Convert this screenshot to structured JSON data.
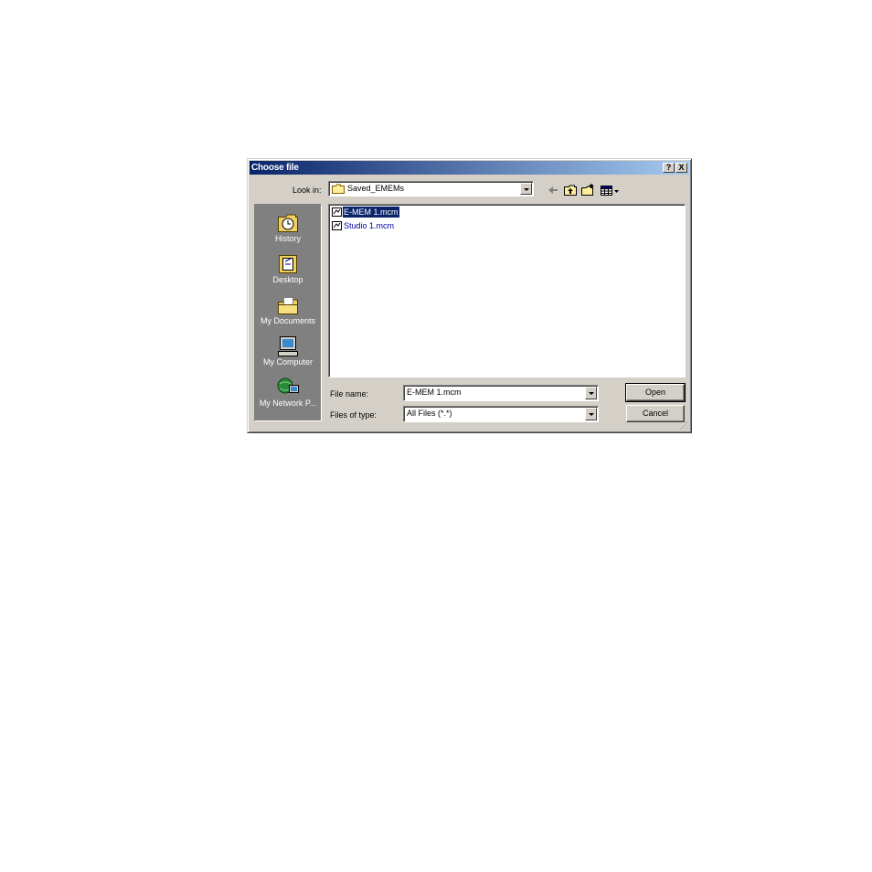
{
  "dialog": {
    "title": "Choose file",
    "help_label": "?",
    "close_label": "X"
  },
  "lookin": {
    "label": "Look in:",
    "value": "Saved_EMEMs"
  },
  "places": [
    {
      "label": "History",
      "icon": "history-icon"
    },
    {
      "label": "Desktop",
      "icon": "desktop-icon"
    },
    {
      "label": "My Documents",
      "icon": "my-documents-icon"
    },
    {
      "label": "My Computer",
      "icon": "my-computer-icon"
    },
    {
      "label": "My Network P...",
      "icon": "network-places-icon"
    }
  ],
  "files": [
    {
      "name": "E-MEM 1.mcm",
      "selected": true
    },
    {
      "name": "Studio 1.mcm",
      "selected": false
    }
  ],
  "filename": {
    "label": "File name:",
    "value": "E-MEM 1.mcm"
  },
  "filetype": {
    "label": "Files of type:",
    "value": "All Files (*.*)"
  },
  "buttons": {
    "open": "Open",
    "cancel": "Cancel"
  },
  "colors": {
    "titlebar_start": "#0a246a",
    "titlebar_end": "#a6caf0",
    "face": "#d4d0c8",
    "selection": "#0a246a"
  }
}
